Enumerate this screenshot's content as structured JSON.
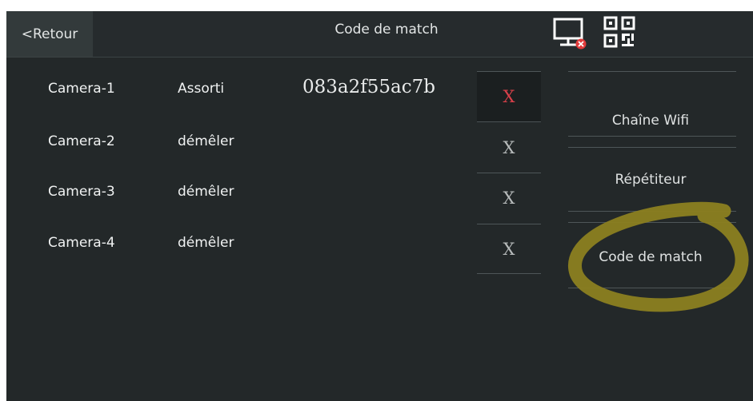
{
  "header": {
    "back_label": "<Retour",
    "title": "Code de match"
  },
  "icons": {
    "monitor": "monitor-disconnected-icon",
    "qr": "qr-code-icon"
  },
  "cameras": [
    {
      "name": "Camera-1",
      "mode": "Assorti",
      "code": "083a2f55ac7b",
      "remove": "X",
      "active": true
    },
    {
      "name": "Camera-2",
      "mode": "démêler",
      "code": "",
      "remove": "X",
      "active": false
    },
    {
      "name": "Camera-3",
      "mode": "démêler",
      "code": "",
      "remove": "X",
      "active": false
    },
    {
      "name": "Camera-4",
      "mode": "démêler",
      "code": "",
      "remove": "X",
      "active": false
    }
  ],
  "sidebar": {
    "items": [
      {
        "label": "Chaîne Wifi"
      },
      {
        "label": "Répétiteur"
      },
      {
        "label": "Code de match"
      }
    ]
  },
  "colors": {
    "background": "#232829",
    "active_remove": "#d9404a",
    "annotation": "#8c7f20"
  }
}
